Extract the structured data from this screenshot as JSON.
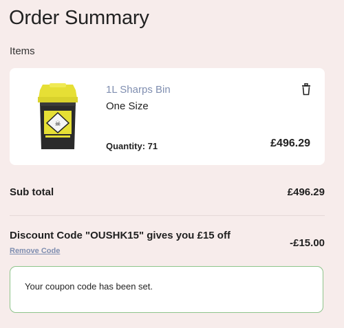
{
  "header": {
    "title": "Order Summary"
  },
  "items_section": {
    "label": "Items"
  },
  "item": {
    "name": "1L Sharps Bin",
    "size": "One Size",
    "quantity_label": "Quantity: ",
    "quantity": "71",
    "price": "£496.29",
    "image_icon": "sharps-bin-icon",
    "delete_icon": "trash-icon"
  },
  "subtotal": {
    "label": "Sub total",
    "value": "£496.29"
  },
  "discount": {
    "label": "Discount Code \"OUSHK15\" gives you £15 off",
    "remove_label": "Remove Code",
    "value": "-£15.00"
  },
  "coupon_message": {
    "text": "Your coupon code has been set."
  },
  "colors": {
    "background": "#f7eceb",
    "link": "#7f8eb0",
    "success_border": "#8cc48a",
    "bin_lid": "#e8e23a",
    "bin_body": "#2a2a2a"
  }
}
